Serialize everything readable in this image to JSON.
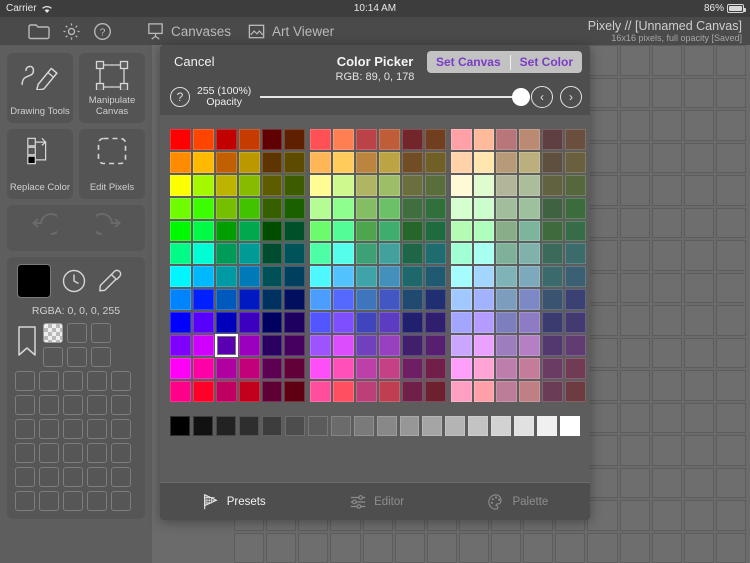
{
  "statusbar": {
    "carrier": "Carrier",
    "wifi_icon": "wifi-icon",
    "time": "10:14 AM",
    "battery_percent": "86%"
  },
  "toolbar": {
    "folder_icon": "folder-icon",
    "gear_icon": "gear-icon",
    "help_icon": "help-icon",
    "canvases_label": "Canvases",
    "canvases_icon": "easel-icon",
    "artviewer_label": "Art Viewer",
    "artviewer_icon": "picture-icon",
    "doc_title": "Pixely // [Unnamed Canvas]",
    "doc_subtitle": "16x16 pixels, full opacity [Saved]"
  },
  "sidebar": {
    "tiles": [
      {
        "label": "Drawing Tools",
        "icon": "pencil-icon"
      },
      {
        "label": "Manipulate Canvas",
        "icon": "transform-box-icon"
      },
      {
        "label": "Replace Color",
        "icon": "replace-color-icon"
      },
      {
        "label": "Edit Pixels",
        "icon": "dashed-square-icon"
      }
    ],
    "undo_label": "undo-icon",
    "redo_label": "redo-icon",
    "current_color_hex": "#000000",
    "rgba_text": "RGBA: 0, 0, 0, 255",
    "history_icon": "clock-icon",
    "eyedropper_icon": "eyedropper-icon",
    "bookmark_icon": "bookmark-icon",
    "swatch_rows": 8,
    "swatch_cols": 5
  },
  "canvas": {
    "cols": 16,
    "rows": 16,
    "cell_color": "#6e6e6e"
  },
  "dialog": {
    "cancel_label": "Cancel",
    "title": "Color Picker",
    "rgb_text": "RGB: 89, 0, 178",
    "set_canvas_label": "Set Canvas",
    "set_color_label": "Set Color",
    "accent_color": "#7b3cc6",
    "help_glyph": "?",
    "opacity_value": "255 (100%)",
    "opacity_label": "Opacity",
    "slider_percent": 100,
    "prev_glyph": "‹",
    "next_glyph": "›",
    "tabs": [
      {
        "label": "Presets",
        "icon": "presets-icon",
        "active": true
      },
      {
        "label": "Editor",
        "icon": "sliders-icon",
        "active": false
      },
      {
        "label": "Palette",
        "icon": "palette-icon",
        "active": false
      }
    ],
    "selected_index": {
      "row": 9,
      "col": 2
    },
    "palette_rows": 12,
    "palette_cols": 18,
    "palette": [
      [
        "#ff0000",
        "#fe4500",
        "#c10000",
        "#c53b00",
        "#600000",
        "#5e2000",
        "#ff5155",
        "#fd7f52",
        "#bb4348",
        "#bf5d39",
        "#72262c",
        "#713f20",
        "#ffa1a6",
        "#ffba9c",
        "#b8757a",
        "#bb8a72",
        "#5f3f42",
        "#6a4f3e"
      ],
      [
        "#ff8c00",
        "#ffb900",
        "#c06000",
        "#bc9800",
        "#5e3400",
        "#5d4c00",
        "#ffb657",
        "#ffcb5b",
        "#bb8540",
        "#bca444",
        "#714d26",
        "#715f28",
        "#ffd2a9",
        "#ffe6ae",
        "#b79a78",
        "#bbb07d",
        "#5e4f3e",
        "#6a6040"
      ],
      [
        "#fbff00",
        "#a5f900",
        "#bcb400",
        "#87bb00",
        "#5d5c00",
        "#3d5c00",
        "#fffc93",
        "#cdfa8e",
        "#b0b563",
        "#9dbd66",
        "#6b6e3d",
        "#5a6e3c",
        "#fff9d6",
        "#e0fcce",
        "#b2b598",
        "#abbd9b",
        "#61623f",
        "#56673e"
      ],
      [
        "#70fc00",
        "#3dfe00",
        "#76be00",
        "#41c300",
        "#366000",
        "#1a6000",
        "#b4fc93",
        "#8efe8e",
        "#84bd63",
        "#6cc167",
        "#3f6e3f",
        "#31703d",
        "#d5ffce",
        "#ccfecd",
        "#a2bd9c",
        "#9dc09d",
        "#3f6340",
        "#3c6b3e"
      ],
      [
        "#00f900",
        "#00fa46",
        "#009e00",
        "#00a84e",
        "#004d00",
        "#00512a",
        "#6cfb6c",
        "#52fd95",
        "#4da54d",
        "#3fae6d",
        "#27662a",
        "#1f6a3f",
        "#b4fcb4",
        "#b0febc",
        "#88ad88",
        "#7cb59c",
        "#3e6a3e",
        "#366c48"
      ],
      [
        "#00fc87",
        "#00fdd3",
        "#009a59",
        "#009b94",
        "#004c30",
        "#005358",
        "#4efea7",
        "#54feea",
        "#3ea075",
        "#42a19c",
        "#1f6547",
        "#1f6c6e",
        "#a2ffd5",
        "#a6fff0",
        "#7eb09a",
        "#80b2ab",
        "#3c6a5a",
        "#3b6c6b"
      ],
      [
        "#00f6ff",
        "#00b8fe",
        "#009aa4",
        "#0079b9",
        "#005157",
        "#003f5e",
        "#4df9ff",
        "#52c3ff",
        "#3fa4aa",
        "#4390bd",
        "#1e686c",
        "#1f5a71",
        "#a5fcff",
        "#a2d6ff",
        "#7fb3b7",
        "#7da9bd",
        "#3b6a6c",
        "#3b6073"
      ],
      [
        "#0083fe",
        "#0020ff",
        "#0059bd",
        "#0019c1",
        "#003160",
        "#00105f",
        "#4b9eff",
        "#5369ff",
        "#3e75bd",
        "#4257c2",
        "#204a70",
        "#1f2f71",
        "#a1c9ff",
        "#a3b2ff",
        "#7c9dbd",
        "#7d89c4",
        "#3a5370",
        "#3c4173"
      ],
      [
        "#0000fe",
        "#5800fe",
        "#0000bc",
        "#3c00bf",
        "#000060",
        "#1d0060",
        "#5355ff",
        "#7e4ffe",
        "#4044bd",
        "#5c3cc0",
        "#20206f",
        "#301f6e",
        "#a3a5ff",
        "#b49bff",
        "#7c7ebd",
        "#8d7cc4",
        "#3a3c6f",
        "#443a72"
      ],
      [
        "#8000fe",
        "#d000fe",
        "#5900b2",
        "#9a00be",
        "#2a0060",
        "#450060",
        "#9f53fe",
        "#dc4dfe",
        "#7141bd",
        "#9740c0",
        "#40206c",
        "#561f6f",
        "#cba6ff",
        "#eba1ff",
        "#9d7dbd",
        "#b47fc4",
        "#53386f",
        "#603c72"
      ],
      [
        "#fe00f6",
        "#fe00a6",
        "#b000a0",
        "#c1007a",
        "#5e0052",
        "#610039",
        "#fe4ef7",
        "#ff4fb9",
        "#bd3fa9",
        "#c44188",
        "#6e1f63",
        "#711f4a",
        "#ff9ffa",
        "#ffa4d4",
        "#bd7eae",
        "#c57c9a",
        "#6b3c63",
        "#713b53"
      ],
      [
        "#ff0089",
        "#ff0029",
        "#bf0061",
        "#c0001d",
        "#5e0035",
        "#5e0011",
        "#ff4f9c",
        "#ff4f61",
        "#bd3f78",
        "#bf3f51",
        "#6f1f48",
        "#6e1f30",
        "#ff9fc4",
        "#ffa0a9",
        "#bd7d99",
        "#c07f85",
        "#6b3c55",
        "#6c3c42"
      ]
    ],
    "grays": [
      "#000000",
      "#111111",
      "#222222",
      "#2e2e2e",
      "#3d3d3d",
      "#4d4d4d",
      "#5b5b5b",
      "#6b6b6b",
      "#7a7a7a",
      "#888888",
      "#979797",
      "#a5a5a5",
      "#b4b4b4",
      "#c3c3c3",
      "#d2d2d2",
      "#e1e1e1",
      "#f0f0f0",
      "#ffffff"
    ]
  }
}
